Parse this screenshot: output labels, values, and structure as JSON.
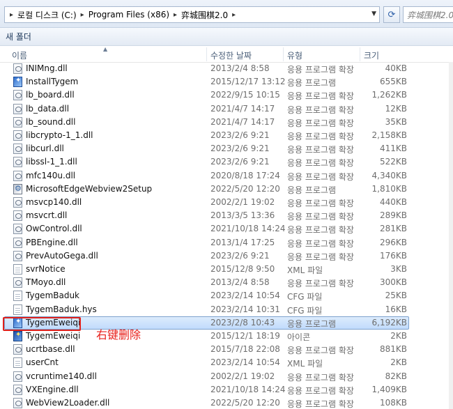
{
  "address": {
    "crumbs": [
      "로컬 디스크 (C:)",
      "Program Files (x86)",
      "弈城围棋2.0"
    ],
    "search_placeholder": "弈城围棋2.0"
  },
  "toolbar": {
    "new_folder": "새 폴더"
  },
  "columns": {
    "name": "이름",
    "date": "수정한 날짜",
    "type": "유형",
    "size": "크기"
  },
  "files": [
    {
      "name": "INIMng.dll",
      "date": "2013/2/4 8:58",
      "type": "응용 프로그램 확장",
      "size": "40KB",
      "icon": "dll"
    },
    {
      "name": "InstallTygem",
      "date": "2015/12/17 13:12",
      "type": "응용 프로그램",
      "size": "655KB",
      "icon": "app"
    },
    {
      "name": "lb_board.dll",
      "date": "2022/9/15 10:15",
      "type": "응용 프로그램 확장",
      "size": "1,262KB",
      "icon": "dll"
    },
    {
      "name": "lb_data.dll",
      "date": "2021/4/7 14:17",
      "type": "응용 프로그램 확장",
      "size": "12KB",
      "icon": "dll"
    },
    {
      "name": "lb_sound.dll",
      "date": "2021/4/7 14:17",
      "type": "응용 프로그램 확장",
      "size": "35KB",
      "icon": "dll"
    },
    {
      "name": "libcrypto-1_1.dll",
      "date": "2023/2/6 9:21",
      "type": "응용 프로그램 확장",
      "size": "2,158KB",
      "icon": "dll"
    },
    {
      "name": "libcurl.dll",
      "date": "2023/2/6 9:21",
      "type": "응용 프로그램 확장",
      "size": "411KB",
      "icon": "dll"
    },
    {
      "name": "libssl-1_1.dll",
      "date": "2023/2/6 9:21",
      "type": "응용 프로그램 확장",
      "size": "522KB",
      "icon": "dll"
    },
    {
      "name": "mfc140u.dll",
      "date": "2020/8/18 17:24",
      "type": "응용 프로그램 확장",
      "size": "4,340KB",
      "icon": "dll"
    },
    {
      "name": "MicrosoftEdgeWebview2Setup",
      "date": "2022/5/20 12:20",
      "type": "응용 프로그램",
      "size": "1,810KB",
      "icon": "setup"
    },
    {
      "name": "msvcp140.dll",
      "date": "2002/2/1 19:02",
      "type": "응용 프로그램 확장",
      "size": "440KB",
      "icon": "dll"
    },
    {
      "name": "msvcrt.dll",
      "date": "2013/3/5 13:36",
      "type": "응용 프로그램 확장",
      "size": "289KB",
      "icon": "dll"
    },
    {
      "name": "OwControl.dll",
      "date": "2021/10/18 14:24",
      "type": "응용 프로그램 확장",
      "size": "281KB",
      "icon": "dll"
    },
    {
      "name": "PBEngine.dll",
      "date": "2013/1/4 17:25",
      "type": "응용 프로그램 확장",
      "size": "296KB",
      "icon": "dll"
    },
    {
      "name": "PrevAutoGega.dll",
      "date": "2023/2/6 9:21",
      "type": "응용 프로그램 확장",
      "size": "176KB",
      "icon": "dll"
    },
    {
      "name": "svrNotice",
      "date": "2015/12/8 9:50",
      "type": "XML 파일",
      "size": "3KB",
      "icon": "file"
    },
    {
      "name": "TMoyo.dll",
      "date": "2013/2/4 8:58",
      "type": "응용 프로그램 확장",
      "size": "300KB",
      "icon": "dll"
    },
    {
      "name": "TygemBaduk",
      "date": "2023/2/14 10:54",
      "type": "CFG 파일",
      "size": "25KB",
      "icon": "file"
    },
    {
      "name": "TygemBaduk.hys",
      "date": "2023/2/14 10:31",
      "type": "CFG 파일",
      "size": "16KB",
      "icon": "file"
    },
    {
      "name": "TygemEweiqi",
      "date": "2023/2/8 10:43",
      "type": "응용 프로그램",
      "size": "6,192KB",
      "icon": "app",
      "selected": true
    },
    {
      "name": "TygemEweiqi",
      "date": "2015/12/1 18:19",
      "type": "아이콘",
      "size": "2KB",
      "icon": "icon"
    },
    {
      "name": "ucrtbase.dll",
      "date": "2015/7/18 22:08",
      "type": "응용 프로그램 확장",
      "size": "881KB",
      "icon": "dll"
    },
    {
      "name": "userCnt",
      "date": "2023/2/14 10:54",
      "type": "XML 파일",
      "size": "2KB",
      "icon": "file"
    },
    {
      "name": "vcruntime140.dll",
      "date": "2002/2/1 19:02",
      "type": "응용 프로그램 확장",
      "size": "82KB",
      "icon": "dll"
    },
    {
      "name": "VXEngine.dll",
      "date": "2021/10/18 14:24",
      "type": "응용 프로그램 확장",
      "size": "1,409KB",
      "icon": "dll"
    },
    {
      "name": "WebView2Loader.dll",
      "date": "2022/5/20 12:20",
      "type": "응용 프로그램 확장",
      "size": "108KB",
      "icon": "dll"
    }
  ],
  "annotation": {
    "text": "右键删除",
    "color": "#e8221d"
  },
  "colors": {
    "selection": "#c1dbfc",
    "selection_border": "#7da2ce",
    "highlight_box": "#e0201b"
  }
}
